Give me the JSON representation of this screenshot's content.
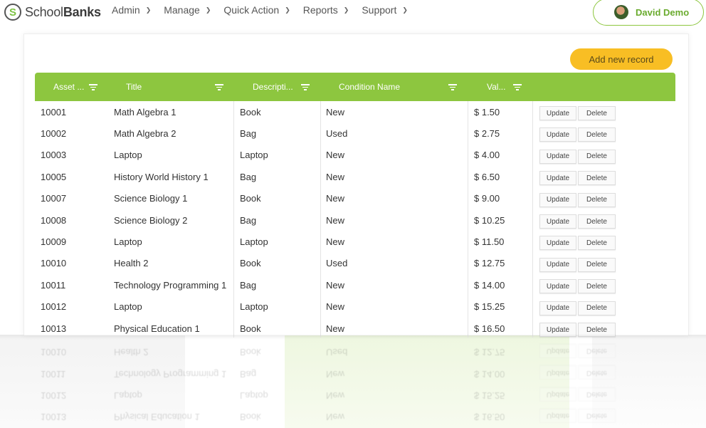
{
  "brand": {
    "name_prefix": "School",
    "name_bold": "Banks",
    "mark": "S"
  },
  "nav": [
    {
      "label": "Admin"
    },
    {
      "label": "Manage"
    },
    {
      "label": "Quick Action"
    },
    {
      "label": "Reports"
    },
    {
      "label": "Support"
    }
  ],
  "user": {
    "name": "David Demo"
  },
  "toolbar": {
    "add_label": "Add new record"
  },
  "colors": {
    "accent_green": "#8dc63f",
    "add_button": "#f8be24"
  },
  "table": {
    "columns": [
      "Asset ...",
      "Title",
      "Descripti...",
      "Condition Name",
      "Val..."
    ],
    "update_label": "Update",
    "delete_label": "Delete",
    "rows": [
      {
        "asset": "10001",
        "title": "Math Algebra 1",
        "desc": "Book",
        "cond": "New",
        "val": "$ 1.50"
      },
      {
        "asset": "10002",
        "title": "Math Algebra 2",
        "desc": "Bag",
        "cond": "Used",
        "val": "$ 2.75"
      },
      {
        "asset": "10003",
        "title": "Laptop",
        "desc": "Laptop",
        "cond": "New",
        "val": "$ 4.00"
      },
      {
        "asset": "10005",
        "title": "History World History 1",
        "desc": "Bag",
        "cond": "New",
        "val": "$ 6.50"
      },
      {
        "asset": "10007",
        "title": "Science Biology 1",
        "desc": "Book",
        "cond": "New",
        "val": "$ 9.00"
      },
      {
        "asset": "10008",
        "title": "Science Biology 2",
        "desc": "Bag",
        "cond": "New",
        "val": "$ 10.25"
      },
      {
        "asset": "10009",
        "title": "Laptop",
        "desc": "Laptop",
        "cond": "New",
        "val": "$ 11.50"
      },
      {
        "asset": "10010",
        "title": "Health 2",
        "desc": "Book",
        "cond": "Used",
        "val": "$ 12.75"
      },
      {
        "asset": "10011",
        "title": "Technology Programming 1",
        "desc": "Bag",
        "cond": "New",
        "val": "$ 14.00"
      },
      {
        "asset": "10012",
        "title": "Laptop",
        "desc": "Laptop",
        "cond": "New",
        "val": "$ 15.25"
      },
      {
        "asset": "10013",
        "title": "Physical Education 1",
        "desc": "Book",
        "cond": "New",
        "val": "$ 16.50"
      }
    ]
  }
}
